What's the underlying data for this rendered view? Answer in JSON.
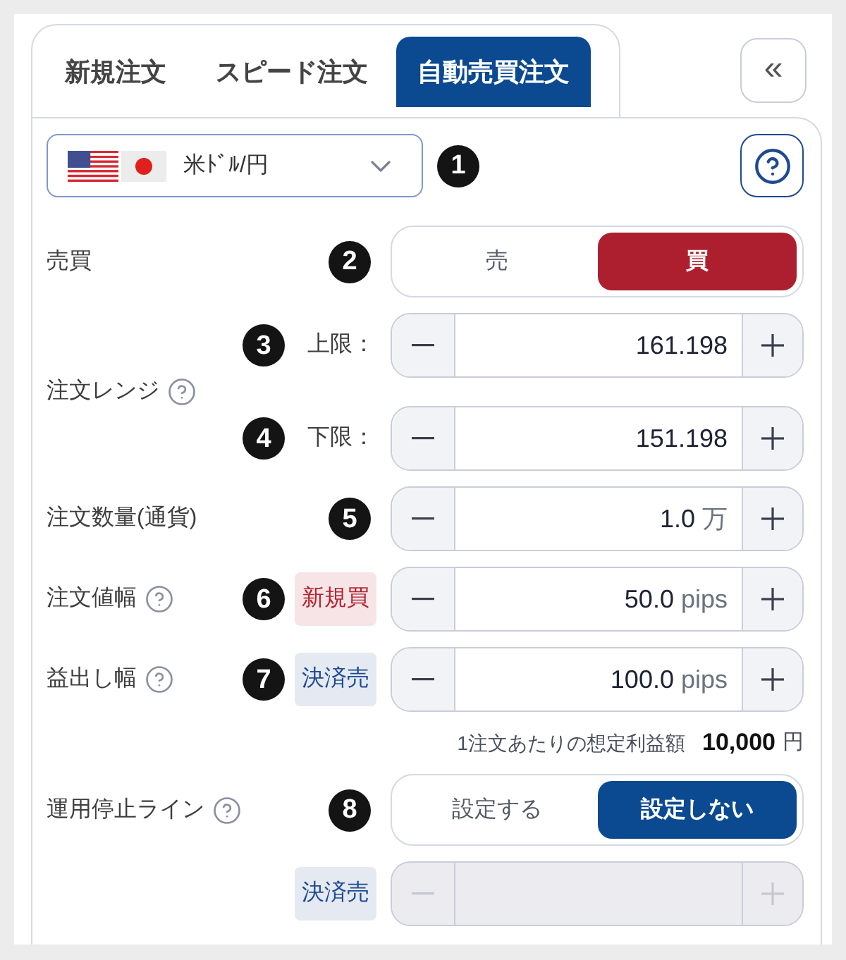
{
  "tabs": [
    {
      "label": "新規注文",
      "selected": false
    },
    {
      "label": "スピード注文",
      "selected": false
    },
    {
      "label": "自動売買注文",
      "selected": true
    }
  ],
  "collapse_button": {
    "label": "«"
  },
  "currency_select": {
    "value": "米ﾄﾞﾙ/円",
    "marker": "1"
  },
  "rows": [
    {
      "kind": "toggle",
      "label": "売買",
      "help": false,
      "marker": "2",
      "color": "#ad1f2e",
      "options": [
        {
          "label": "売",
          "selected": false
        },
        {
          "label": "買",
          "selected": true
        }
      ]
    },
    {
      "kind": "range",
      "label": "注文レンジ",
      "help": true,
      "bounds": [
        {
          "marker": "3",
          "label": "上限：",
          "value": "161.198",
          "disabled": false
        },
        {
          "marker": "4",
          "label": "下限：",
          "value": "151.198",
          "disabled": false
        }
      ]
    },
    {
      "kind": "stepper",
      "label": "注文数量(通貨)",
      "help": false,
      "marker": "5",
      "value": "1.0",
      "unit": "万",
      "disabled": false
    },
    {
      "kind": "stepper",
      "label": "注文値幅",
      "help": true,
      "marker": "6",
      "tag": {
        "text": "新規買",
        "color": "#b3202f"
      },
      "value": "50.0",
      "unit": "pips",
      "disabled": false
    },
    {
      "kind": "stepper",
      "label": "益出し幅",
      "help": true,
      "marker": "7",
      "tag": {
        "text": "決済売",
        "color": "#1f4a8f"
      },
      "value": "100.0",
      "unit": "pips",
      "disabled": false
    },
    {
      "kind": "note",
      "label": "1注文あたりの想定利益額",
      "amount": "10,000",
      "unit": "円"
    },
    {
      "kind": "toggle",
      "label": "運用停止ライン",
      "help": true,
      "marker": "8",
      "color": "#0b4a90",
      "options": [
        {
          "label": "設定する",
          "selected": false
        },
        {
          "label": "設定しない",
          "selected": true
        }
      ]
    },
    {
      "kind": "stepper",
      "tag": {
        "text": "決済売",
        "color": "#1f4a8f"
      },
      "disabled": true
    }
  ]
}
